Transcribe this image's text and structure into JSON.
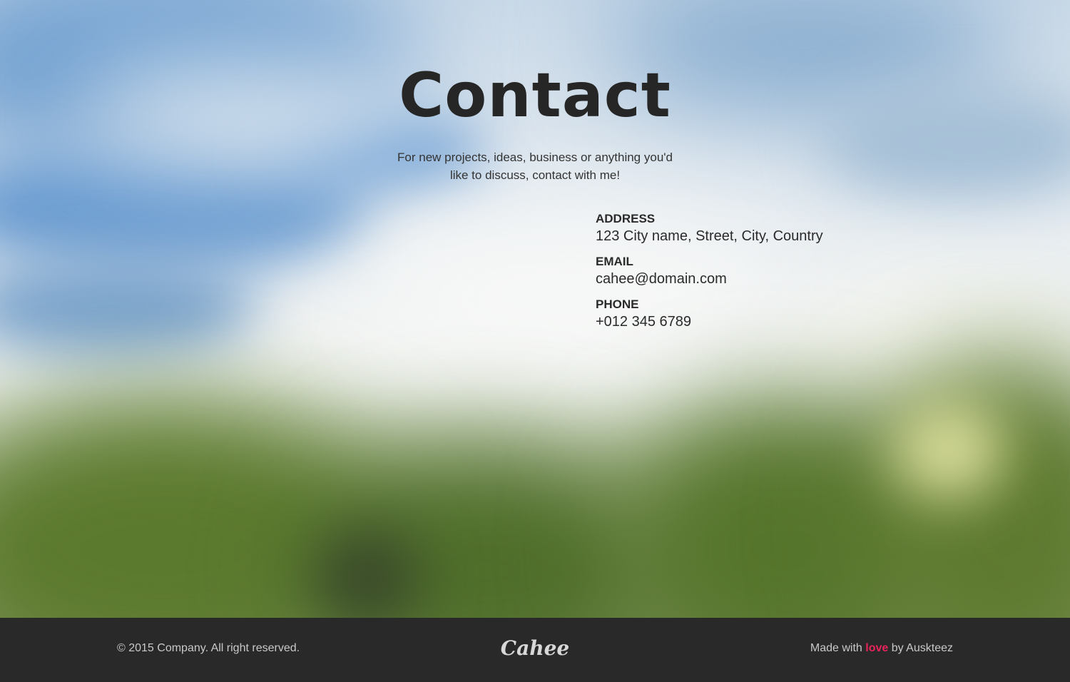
{
  "hero": {
    "title": "Contact",
    "intro": "For new projects, ideas, business or anything you'd like to discuss, contact with me!"
  },
  "contact_info": [
    {
      "label": "ADDRESS",
      "value": "123 City name, Street, City, Country"
    },
    {
      "label": "EMAIL",
      "value": "cahee@domain.com"
    },
    {
      "label": "PHONE",
      "value": "+012 345 6789"
    }
  ],
  "footer": {
    "copyright": "© 2015 Company. All right reserved.",
    "logo": "Cahee",
    "credit_prefix": "Made with",
    "credit_love": "love",
    "credit_suffix": "by Auskteez"
  },
  "colors": {
    "footer_bg": "#292929",
    "accent": "#e8245a",
    "text_dark": "#262626"
  }
}
